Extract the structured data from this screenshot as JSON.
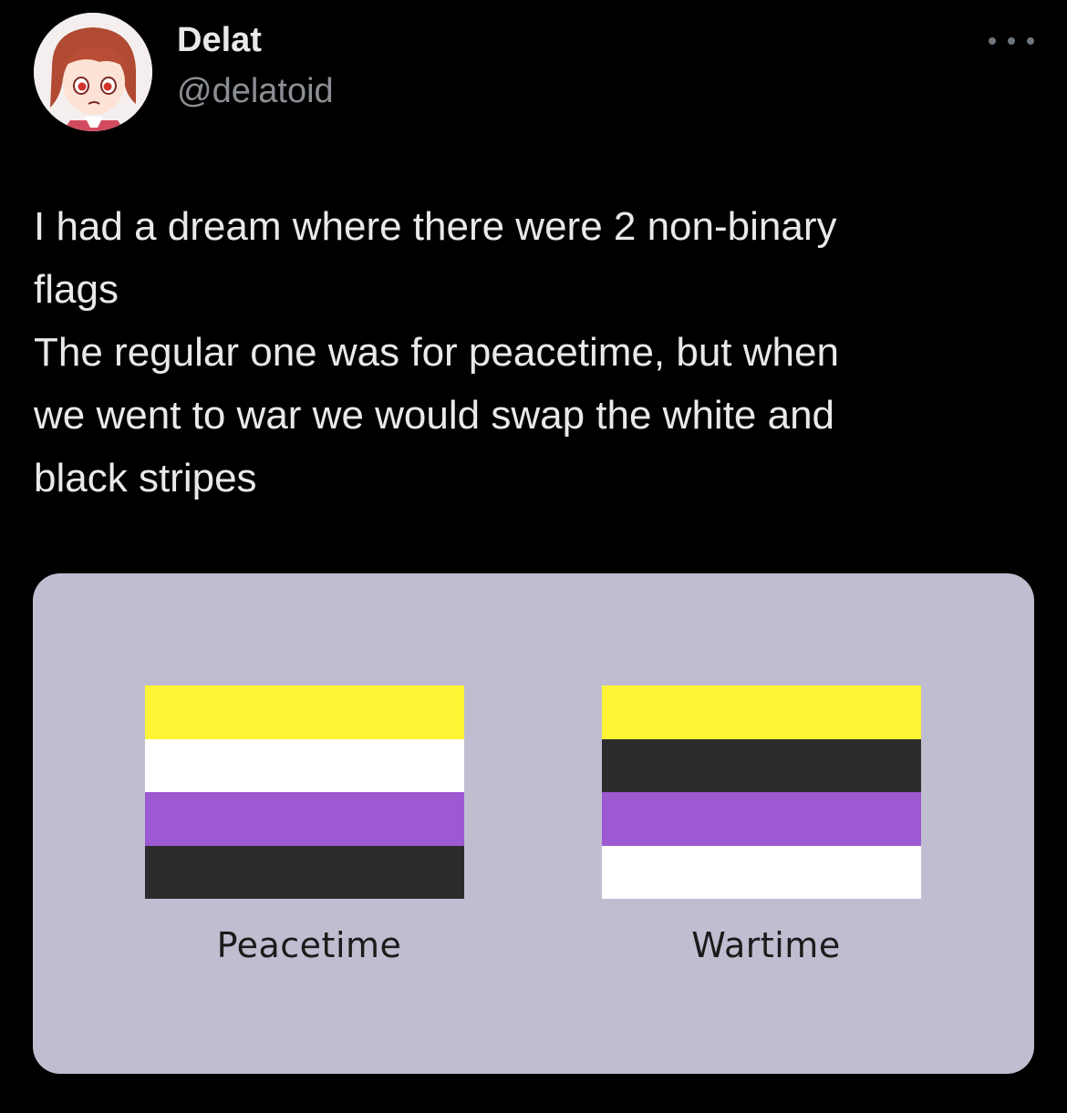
{
  "author": {
    "display_name": "Delat",
    "handle": "@delatoid",
    "avatar_icon": "anime-character-avatar"
  },
  "more_menu_icon": "more-horizontal-icon",
  "tweet": {
    "text_lines": [
      "I had a dream where there were 2 non-binary",
      "flags",
      "The regular one was for peacetime, but when",
      "we went to war we would swap the white and",
      "black stripes"
    ]
  },
  "media": {
    "background": "#c0bdd1",
    "flags": [
      {
        "caption": "Peacetime",
        "stripes": [
          "#fcf434",
          "#ffffff",
          "#9c59d1",
          "#2c2c2c"
        ]
      },
      {
        "caption": "Wartime",
        "stripes": [
          "#fcf434",
          "#2c2c2c",
          "#9c59d1",
          "#ffffff"
        ]
      }
    ]
  }
}
